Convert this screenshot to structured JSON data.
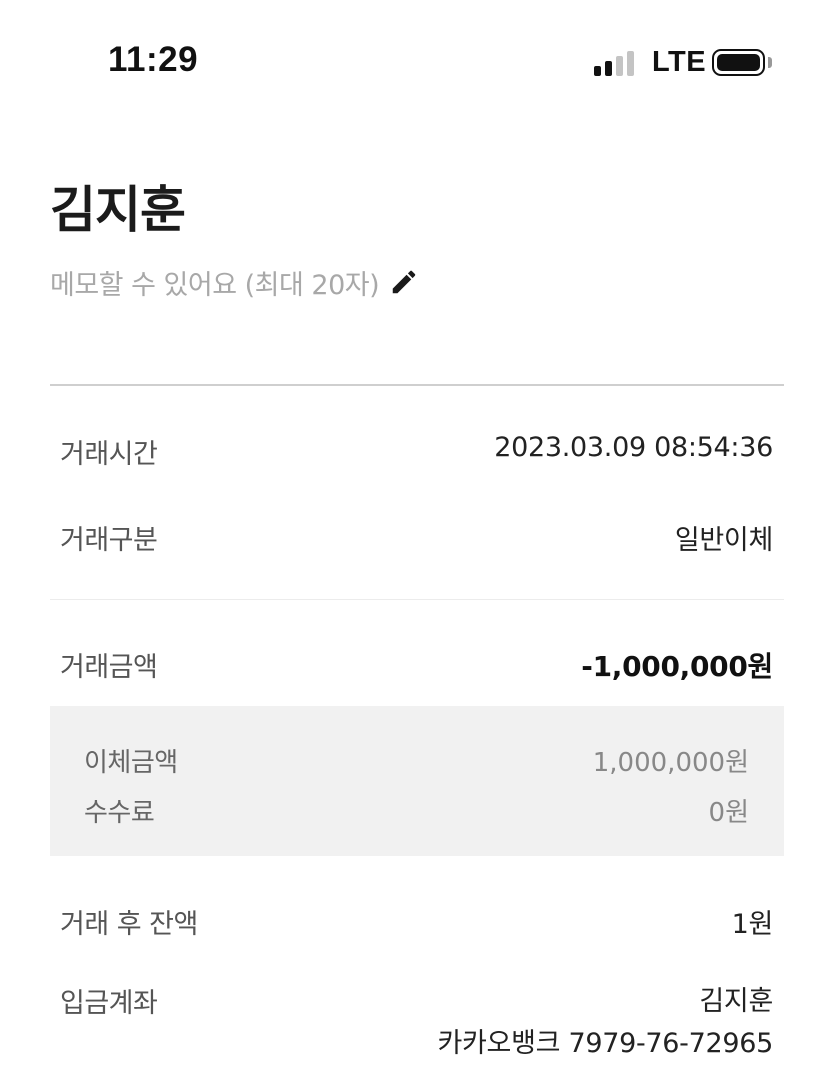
{
  "status_bar": {
    "time": "11:29",
    "network": "LTE",
    "signal_bars": 4,
    "signal_active": 2,
    "battery_level": 1.0
  },
  "recipient": {
    "name": "김지훈",
    "memo_placeholder": "메모할 수 있어요 (최대 20자)",
    "edit_icon": "pencil-icon"
  },
  "details": {
    "time_label": "거래시간",
    "time_value": "2023.03.09 08:54:36",
    "type_label": "거래구분",
    "type_value": "일반이체",
    "amount_label": "거래금액",
    "amount_value": "-1,000,000원",
    "breakdown": {
      "transfer_label": "이체금액",
      "transfer_value": "1,000,000원",
      "fee_label": "수수료",
      "fee_value": "0원"
    },
    "balance_label": "거래 후 잔액",
    "balance_value": "1원",
    "account_label": "입금계좌",
    "account_holder": "김지훈",
    "account_number": "카카오뱅크 7979-76-72965"
  },
  "colors": {
    "background": "#ffffff",
    "text_primary": "#1e1e1e",
    "text_muted": "#a8a8a8",
    "divider": "#cfcfcf",
    "fee_box": "#f1f1f1"
  }
}
